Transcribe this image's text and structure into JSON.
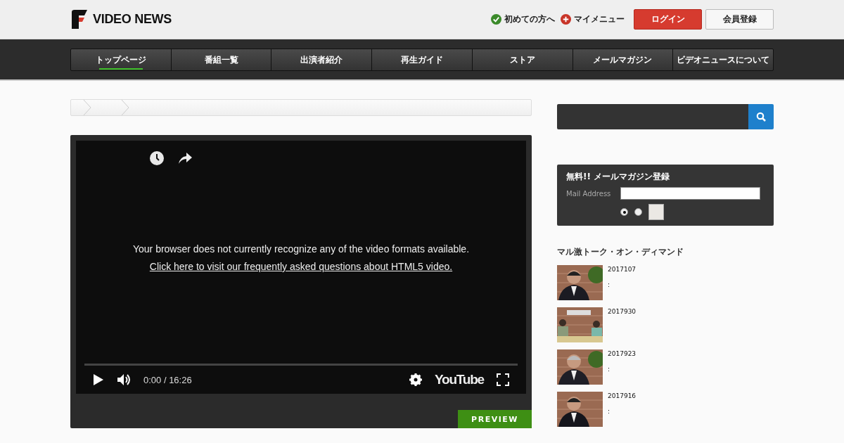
{
  "header": {
    "logo": "VIDEO NEWS",
    "links": [
      {
        "label": "初めての方へ",
        "kind": "check"
      },
      {
        "label": "マイメニュー",
        "kind": "plus"
      }
    ],
    "buttons": [
      {
        "label": "ログイン",
        "kind": "primary"
      },
      {
        "label": "会員登録",
        "kind": "secondary"
      }
    ]
  },
  "nav": [
    {
      "label": "トップページ",
      "selected": true
    },
    {
      "label": "番組一覧",
      "selected": false
    },
    {
      "label": "出演者紹介",
      "selected": false
    },
    {
      "label": "再生ガイド",
      "selected": false
    },
    {
      "label": "ストア",
      "selected": false
    },
    {
      "label": "メールマガジン",
      "selected": false
    },
    {
      "label": "ビデオニュースについて",
      "selected": false
    }
  ],
  "player": {
    "message": "Your browser does not currently recognize any of the video formats available.",
    "link": "Click here to visit our frequently asked questions about HTML5 video.",
    "time": "0:00 / 16:26",
    "brand": "YouTube"
  },
  "preview": "PREVIEW",
  "newsletter": {
    "title": "無料!! メールマガジン登録",
    "label": "Mail Address",
    "options": [
      {
        "selected": true
      },
      {
        "selected": false
      }
    ]
  },
  "talk": {
    "title": "マル激トーク・オン・ディマンド",
    "items": [
      {
        "date": "2017107",
        "note": ":"
      },
      {
        "date": "2017930"
      },
      {
        "date": "2017923",
        "note": ":"
      },
      {
        "date": "2017916",
        "note": ":"
      }
    ]
  }
}
